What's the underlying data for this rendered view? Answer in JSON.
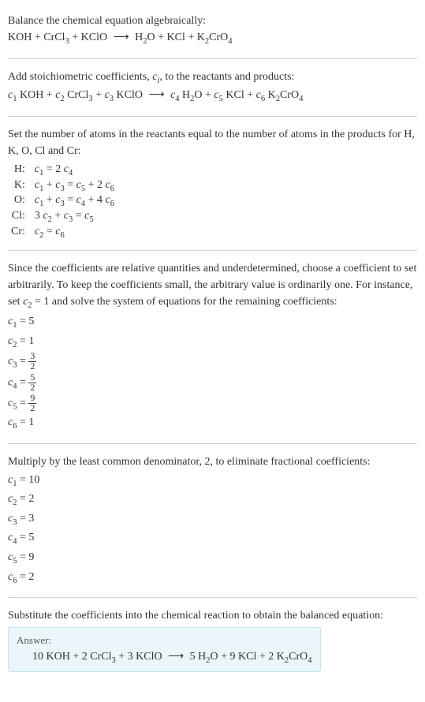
{
  "section1": {
    "heading": "Balance the chemical equation algebraically:",
    "equation": "KOH + CrCl₃ + KClO ⟶ H₂O + KCl + K₂CrO₄"
  },
  "section2": {
    "heading_before": "Add stoichiometric coefficients, ",
    "ci": "cᵢ",
    "heading_after": ", to the reactants and products:",
    "equation": "c₁ KOH + c₂ CrCl₃ + c₃ KClO ⟶ c₄ H₂O + c₅ KCl + c₆ K₂CrO₄"
  },
  "section3": {
    "heading": "Set the number of atoms in the reactants equal to the number of atoms in the products for H, K, O, Cl and Cr:",
    "rows": [
      {
        "label": "H:",
        "eq": "c₁ = 2 c₄"
      },
      {
        "label": "K:",
        "eq": "c₁ + c₃ = c₅ + 2 c₆"
      },
      {
        "label": "O:",
        "eq": "c₁ + c₃ = c₄ + 4 c₆"
      },
      {
        "label": "Cl:",
        "eq": "3 c₂ + c₃ = c₅"
      },
      {
        "label": "Cr:",
        "eq": "c₂ = c₆"
      }
    ]
  },
  "section4": {
    "heading": "Since the coefficients are relative quantities and underdetermined, choose a coefficient to set arbitrarily. To keep the coefficients small, the arbitrary value is ordinarily one. For instance, set c₂ = 1 and solve the system of equations for the remaining coefficients:",
    "coeffs": [
      {
        "lhs": "c₁",
        "rhs": "5",
        "frac": false
      },
      {
        "lhs": "c₂",
        "rhs": "1",
        "frac": false
      },
      {
        "lhs": "c₃",
        "num": "3",
        "den": "2",
        "frac": true
      },
      {
        "lhs": "c₄",
        "num": "5",
        "den": "2",
        "frac": true
      },
      {
        "lhs": "c₅",
        "num": "9",
        "den": "2",
        "frac": true
      },
      {
        "lhs": "c₆",
        "rhs": "1",
        "frac": false
      }
    ]
  },
  "section5": {
    "heading": "Multiply by the least common denominator, 2, to eliminate fractional coefficients:",
    "coeffs": [
      {
        "lhs": "c₁",
        "rhs": "10"
      },
      {
        "lhs": "c₂",
        "rhs": "2"
      },
      {
        "lhs": "c₃",
        "rhs": "3"
      },
      {
        "lhs": "c₄",
        "rhs": "5"
      },
      {
        "lhs": "c₅",
        "rhs": "9"
      },
      {
        "lhs": "c₆",
        "rhs": "2"
      }
    ]
  },
  "section6": {
    "heading": "Substitute the coefficients into the chemical reaction to obtain the balanced equation:",
    "answer_label": "Answer:",
    "answer_eq": "10 KOH + 2 CrCl₃ + 3 KClO ⟶ 5 H₂O + 9 KCl + 2 K₂CrO₄"
  }
}
